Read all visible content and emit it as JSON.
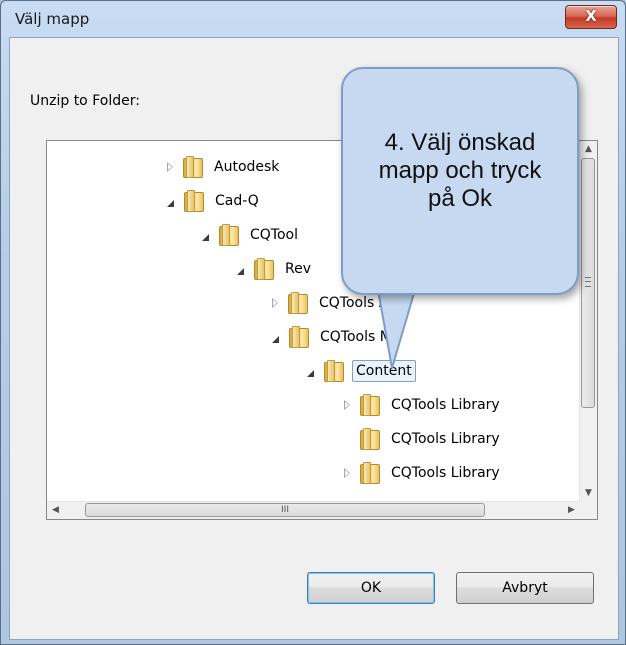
{
  "window": {
    "title": "Välj mapp",
    "close_glyph": "X"
  },
  "prompt": "Unzip to Folder:",
  "tree": {
    "items": [
      {
        "label": "Autodesk",
        "expander": "closed"
      },
      {
        "label": "Cad-Q",
        "expander": "open"
      },
      {
        "label": "CQTool",
        "expander": "open"
      },
      {
        "label": "Rev",
        "expander": "open"
      },
      {
        "label": "CQTools A",
        "expander": "closed"
      },
      {
        "label": "CQTools MP",
        "expander": "open"
      },
      {
        "label": "Content",
        "expander": "open",
        "selected": true
      },
      {
        "label": "CQTools Library",
        "expander": "closed"
      },
      {
        "label": "CQTools Library",
        "expander": "none"
      },
      {
        "label": "CQTools Library",
        "expander": "closed"
      }
    ],
    "hscroll_grip": "III",
    "vscroll_up": "▲",
    "vscroll_down": "▼",
    "hscroll_left": "◀",
    "hscroll_right": "▶"
  },
  "buttons": {
    "ok": "OK",
    "cancel": "Avbryt"
  },
  "callout": {
    "text": "4. Välj önskad\nmapp och tryck\npå Ok",
    "fill": "#c6d9f1",
    "border": "#7f9dc4"
  },
  "colors": {
    "accent": "#3c7fb1",
    "close": "#c43c25"
  }
}
